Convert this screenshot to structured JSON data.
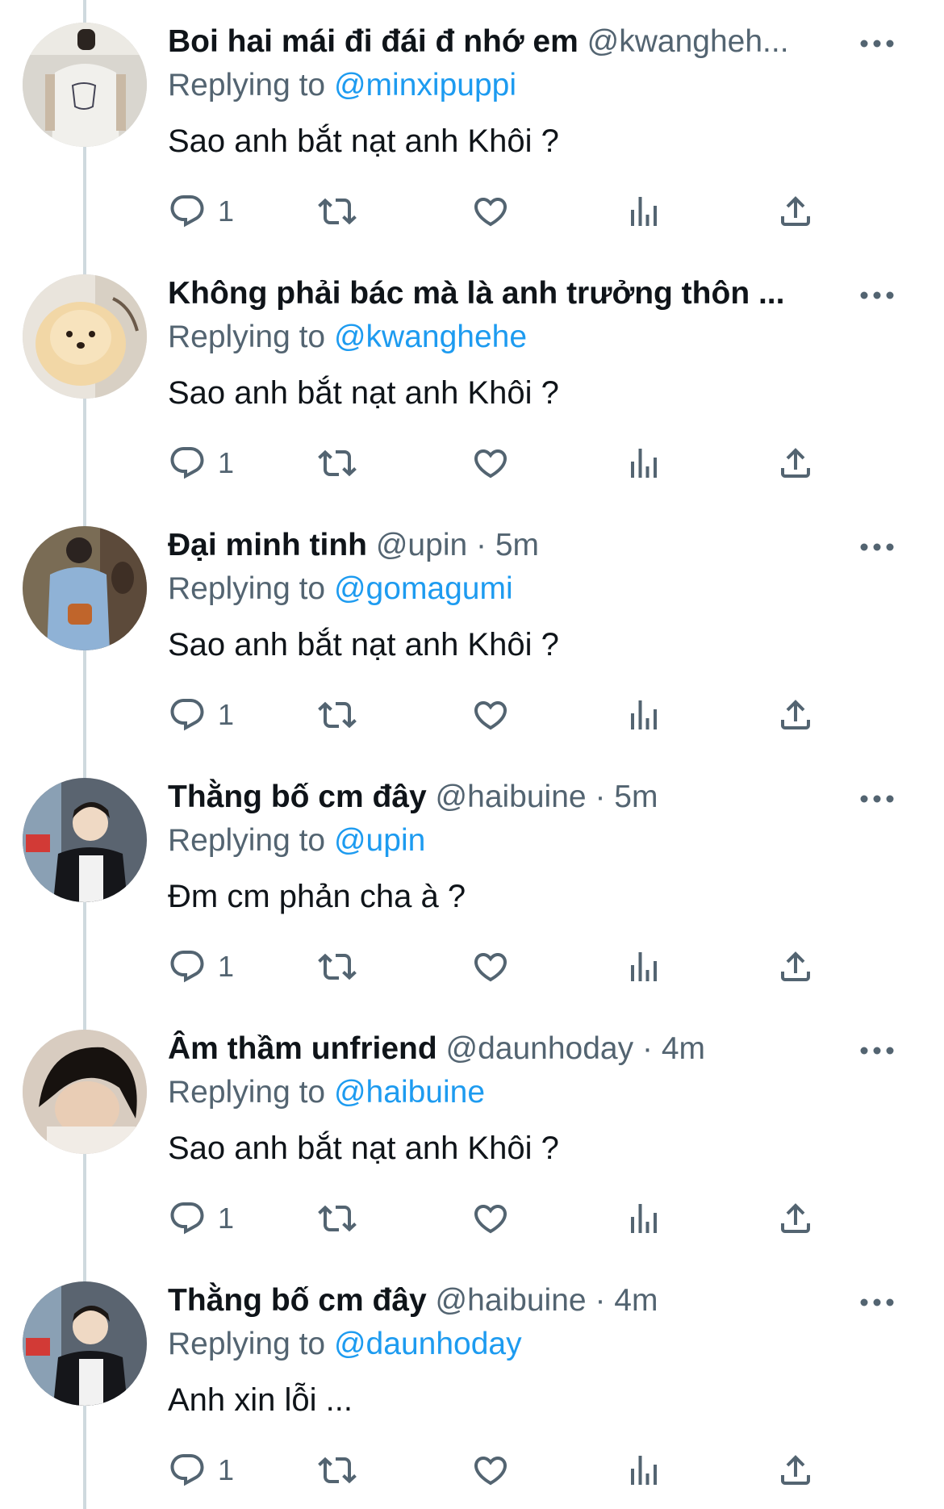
{
  "replying_prefix": "Replying to",
  "icons": {
    "reply": "reply-bubble-icon",
    "retweet": "retweet-icon",
    "like": "heart-icon",
    "views": "views-chart-icon",
    "share": "share-icon",
    "more": "more-dots-icon"
  },
  "colors": {
    "text": "#0f1419",
    "secondary": "#536471",
    "mention": "#1d9bf0",
    "thread_line": "#cfd9de"
  },
  "tweets": [
    {
      "name": "Boi hai mái đi đái đ nhớ em",
      "handle": "@kwangheh...",
      "time": "",
      "reply_to": "@minxipuppi",
      "text": "Sao anh bắt nạt anh Khôi ?",
      "reply_count": "1"
    },
    {
      "name": "Không phải bác mà là anh trưởng thôn ...",
      "handle": "",
      "time": "",
      "reply_to": "@kwanghehe",
      "text": "Sao anh bắt nạt anh Khôi ?",
      "reply_count": "1"
    },
    {
      "name": "Đại minh tinh",
      "handle": "@upin",
      "time": "5m",
      "reply_to": "@gomagumi",
      "text": "Sao anh bắt nạt anh Khôi ?",
      "reply_count": "1"
    },
    {
      "name": "Thằng bố cm đây",
      "handle": "@haibuine",
      "time": "5m",
      "reply_to": "@upin",
      "text": "Đm cm phản cha à ?",
      "reply_count": "1"
    },
    {
      "name": "Âm thầm unfriend",
      "handle": "@daunhoday",
      "time": "4m",
      "reply_to": "@haibuine",
      "text": "Sao anh bắt nạt anh Khôi ?",
      "reply_count": "1"
    },
    {
      "name": "Thằng bố cm đây",
      "handle": "@haibuine",
      "time": "4m",
      "reply_to": "@daunhoday",
      "text": "Anh xin lỗi ...",
      "reply_count": "1"
    }
  ]
}
